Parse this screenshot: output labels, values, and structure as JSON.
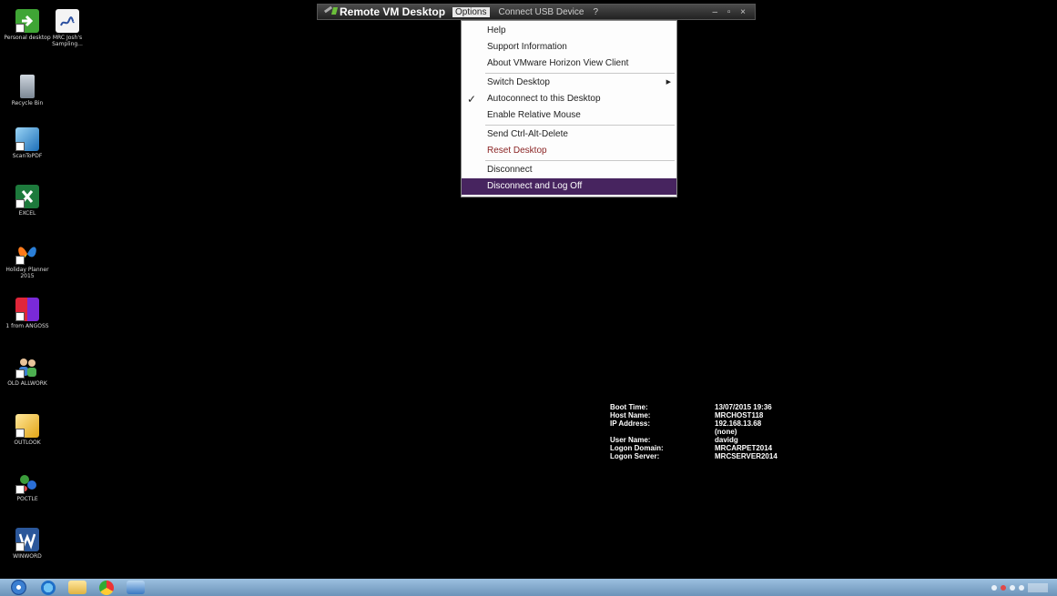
{
  "vm_toolbar": {
    "title": "Remote VM Desktop",
    "menus": [
      "Options",
      "Connect USB Device",
      "?"
    ],
    "window_controls": "– ▫ ×"
  },
  "options_menu": {
    "items": [
      {
        "label": "Help"
      },
      {
        "label": "Support Information"
      },
      {
        "label": "About VMware Horizon View Client"
      },
      {
        "label": "Switch Desktop"
      },
      {
        "label": "Autoconnect to this Desktop",
        "checked": true
      },
      {
        "label": "Enable Relative Mouse"
      },
      {
        "label": "Send Ctrl-Alt-Delete"
      },
      {
        "label": "Reset Desktop"
      },
      {
        "label": "Disconnect"
      },
      {
        "label": "Disconnect and Log Off",
        "highlighted": true
      }
    ]
  },
  "desktop_icons": [
    {
      "label": "Personal desktop",
      "icon": "green-arrow-icon"
    },
    {
      "label": "MRC Josh's Sampling...",
      "icon": "document-icon"
    },
    {
      "label": "Recycle Bin",
      "icon": "recycle-bin-icon"
    },
    {
      "label": "ScanToPDF",
      "icon": "scan-icon"
    },
    {
      "label": "EXCEL",
      "icon": "excel-icon"
    },
    {
      "label": "Holiday Planner 2015",
      "icon": "butterfly-icon"
    },
    {
      "label": "1 from ANGOSS",
      "icon": "color-blocks-icon"
    },
    {
      "label": "OLD ALLWORK",
      "icon": "users-icon"
    },
    {
      "label": "OUTLOOK",
      "icon": "outlook-icon"
    },
    {
      "label": "POCTLE",
      "icon": "molecule-icon"
    },
    {
      "label": "WINWORD",
      "icon": "word-icon"
    }
  ],
  "bginfo": {
    "rows": [
      {
        "key": "Boot Time:",
        "value": "13/07/2015 19:36"
      },
      {
        "key": "Host Name:",
        "value": "MRCHOST118"
      },
      {
        "key": "IP Address:",
        "value": "192.168.13.68"
      },
      {
        "key": "",
        "value": "(none)"
      },
      {
        "key": "User Name:",
        "value": "davidg"
      },
      {
        "key": "Logon Domain:",
        "value": "MRCARPET2014"
      },
      {
        "key": "Logon Server:",
        "value": "MRCSERVER2014"
      }
    ]
  },
  "colors": {
    "menu_highlight": "#47245f",
    "reset_desktop_text": "#8b2525",
    "taskbar": "#8fb4d8"
  }
}
